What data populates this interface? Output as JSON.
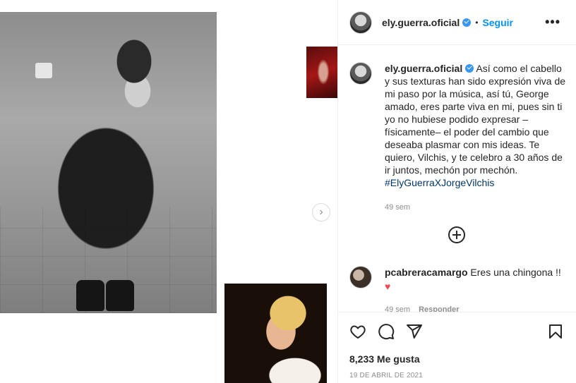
{
  "post": {
    "username": "ely.guerra.oficial",
    "follow_label": "Seguir",
    "dot": "•",
    "caption": {
      "username": "ely.guerra.oficial",
      "text": "Así como el cabello y sus texturas han sido expresión viva de mi paso por la música, así tú, George amado, eres parte viva en mi, pues sin ti yo no hubiese podido expresar –físicamente– el poder del cambio que deseaba plasmar con mis ideas. Te quiero, Vilchis, y te celebro a 30 años de ir juntos, mechón por mechón.",
      "hashtag": "#ElyGuerraXJorgeVilchis",
      "age": "49 sem"
    },
    "comments": [
      {
        "username": "pcabreracamargo",
        "text": "Eres una chingona !!",
        "emoji": "♥",
        "age": "49 sem",
        "reply_label": "Responder"
      }
    ],
    "likes_label": "8,233 Me gusta",
    "date": "19 DE ABRIL DE 2021"
  },
  "icons": {
    "more": "more-options-icon",
    "next": "chevron-right-icon",
    "load_more": "plus-circle-icon",
    "like": "heart-icon",
    "comment": "comment-icon",
    "share": "paper-plane-icon",
    "save": "bookmark-icon",
    "verified": "verified-badge-icon"
  },
  "colors": {
    "accent": "#0095f6",
    "verified": "#3897f0",
    "hashtag": "#00376b",
    "muted": "#8e8e8e",
    "heart": "#ed4956"
  }
}
